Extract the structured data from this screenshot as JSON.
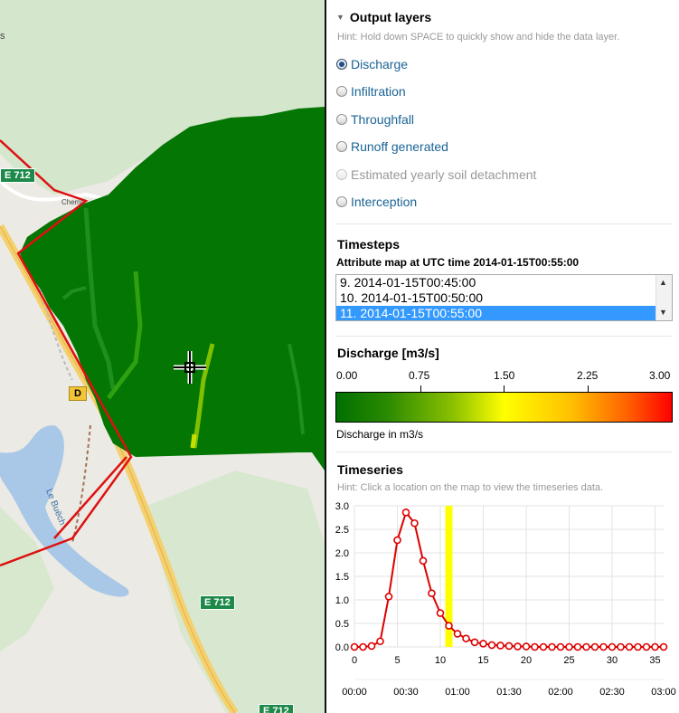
{
  "map": {
    "road_labels": [
      "E 712",
      "E 712",
      "E 712",
      "D"
    ],
    "place_labels": [
      "Chemi",
      "Le Buëch",
      "s"
    ],
    "cursor_icon": "crosshair-icon"
  },
  "panel": {
    "output_layers": {
      "title": "Output layers",
      "hint": "Hint: Hold down SPACE to quickly show and hide the data layer.",
      "options": [
        {
          "label": "Discharge",
          "checked": true,
          "disabled": false
        },
        {
          "label": "Infiltration",
          "checked": false,
          "disabled": false
        },
        {
          "label": "Throughfall",
          "checked": false,
          "disabled": false
        },
        {
          "label": "Runoff generated",
          "checked": false,
          "disabled": false
        },
        {
          "label": "Estimated yearly soil detachment",
          "checked": false,
          "disabled": true
        },
        {
          "label": "Interception",
          "checked": false,
          "disabled": false
        }
      ]
    },
    "timesteps": {
      "title": "Timesteps",
      "subtitle": "Attribute map at UTC time 2014-01-15T00:55:00",
      "items": [
        "9. 2014-01-15T00:45:00",
        "10. 2014-01-15T00:50:00",
        "11. 2014-01-15T00:55:00"
      ],
      "selected_index": 2
    },
    "legend": {
      "title": "Discharge [m3/s]",
      "ticks": [
        "0.00",
        "0.75",
        "1.50",
        "2.25",
        "3.00"
      ],
      "caption": "Discharge in m3/s",
      "colors": [
        "#007000",
        "#8cc100",
        "#ffff00",
        "#ffc000",
        "#ff0000"
      ]
    },
    "timeseries": {
      "title": "Timeseries",
      "hint": "Hint: Click a location on the map to view the timeseries data."
    }
  },
  "chart_data": {
    "type": "line",
    "x": [
      0,
      1,
      2,
      3,
      4,
      5,
      6,
      7,
      8,
      9,
      10,
      11,
      12,
      13,
      14,
      15,
      16,
      17,
      18,
      19,
      20,
      21,
      22,
      23,
      24,
      25,
      26,
      27,
      28,
      29,
      30,
      31,
      32,
      33,
      34,
      35,
      36
    ],
    "values": [
      0.0,
      0.0,
      0.02,
      0.12,
      1.07,
      2.27,
      2.86,
      2.63,
      1.83,
      1.14,
      0.72,
      0.45,
      0.28,
      0.18,
      0.1,
      0.07,
      0.04,
      0.03,
      0.02,
      0.01,
      0.01,
      0.0,
      0.0,
      0.0,
      0.0,
      0.0,
      0.0,
      0.0,
      0.0,
      0.0,
      0.0,
      0.0,
      0.0,
      0.0,
      0.0,
      0.0,
      0.0
    ],
    "ylim": [
      0,
      3.0
    ],
    "xlim": [
      0,
      36
    ],
    "yticks": [
      "0.0",
      "0.5",
      "1.0",
      "1.5",
      "2.0",
      "2.5",
      "3.0"
    ],
    "xticks": [
      "0",
      "5",
      "10",
      "15",
      "20",
      "25",
      "30",
      "35"
    ],
    "time_ticks": [
      "00:00",
      "00:30",
      "01:00",
      "01:30",
      "02:00",
      "02:30",
      "03:00"
    ],
    "highlight_x": 11,
    "line_color": "#dd0000",
    "highlight_color": "#ffff00",
    "grid": true
  }
}
